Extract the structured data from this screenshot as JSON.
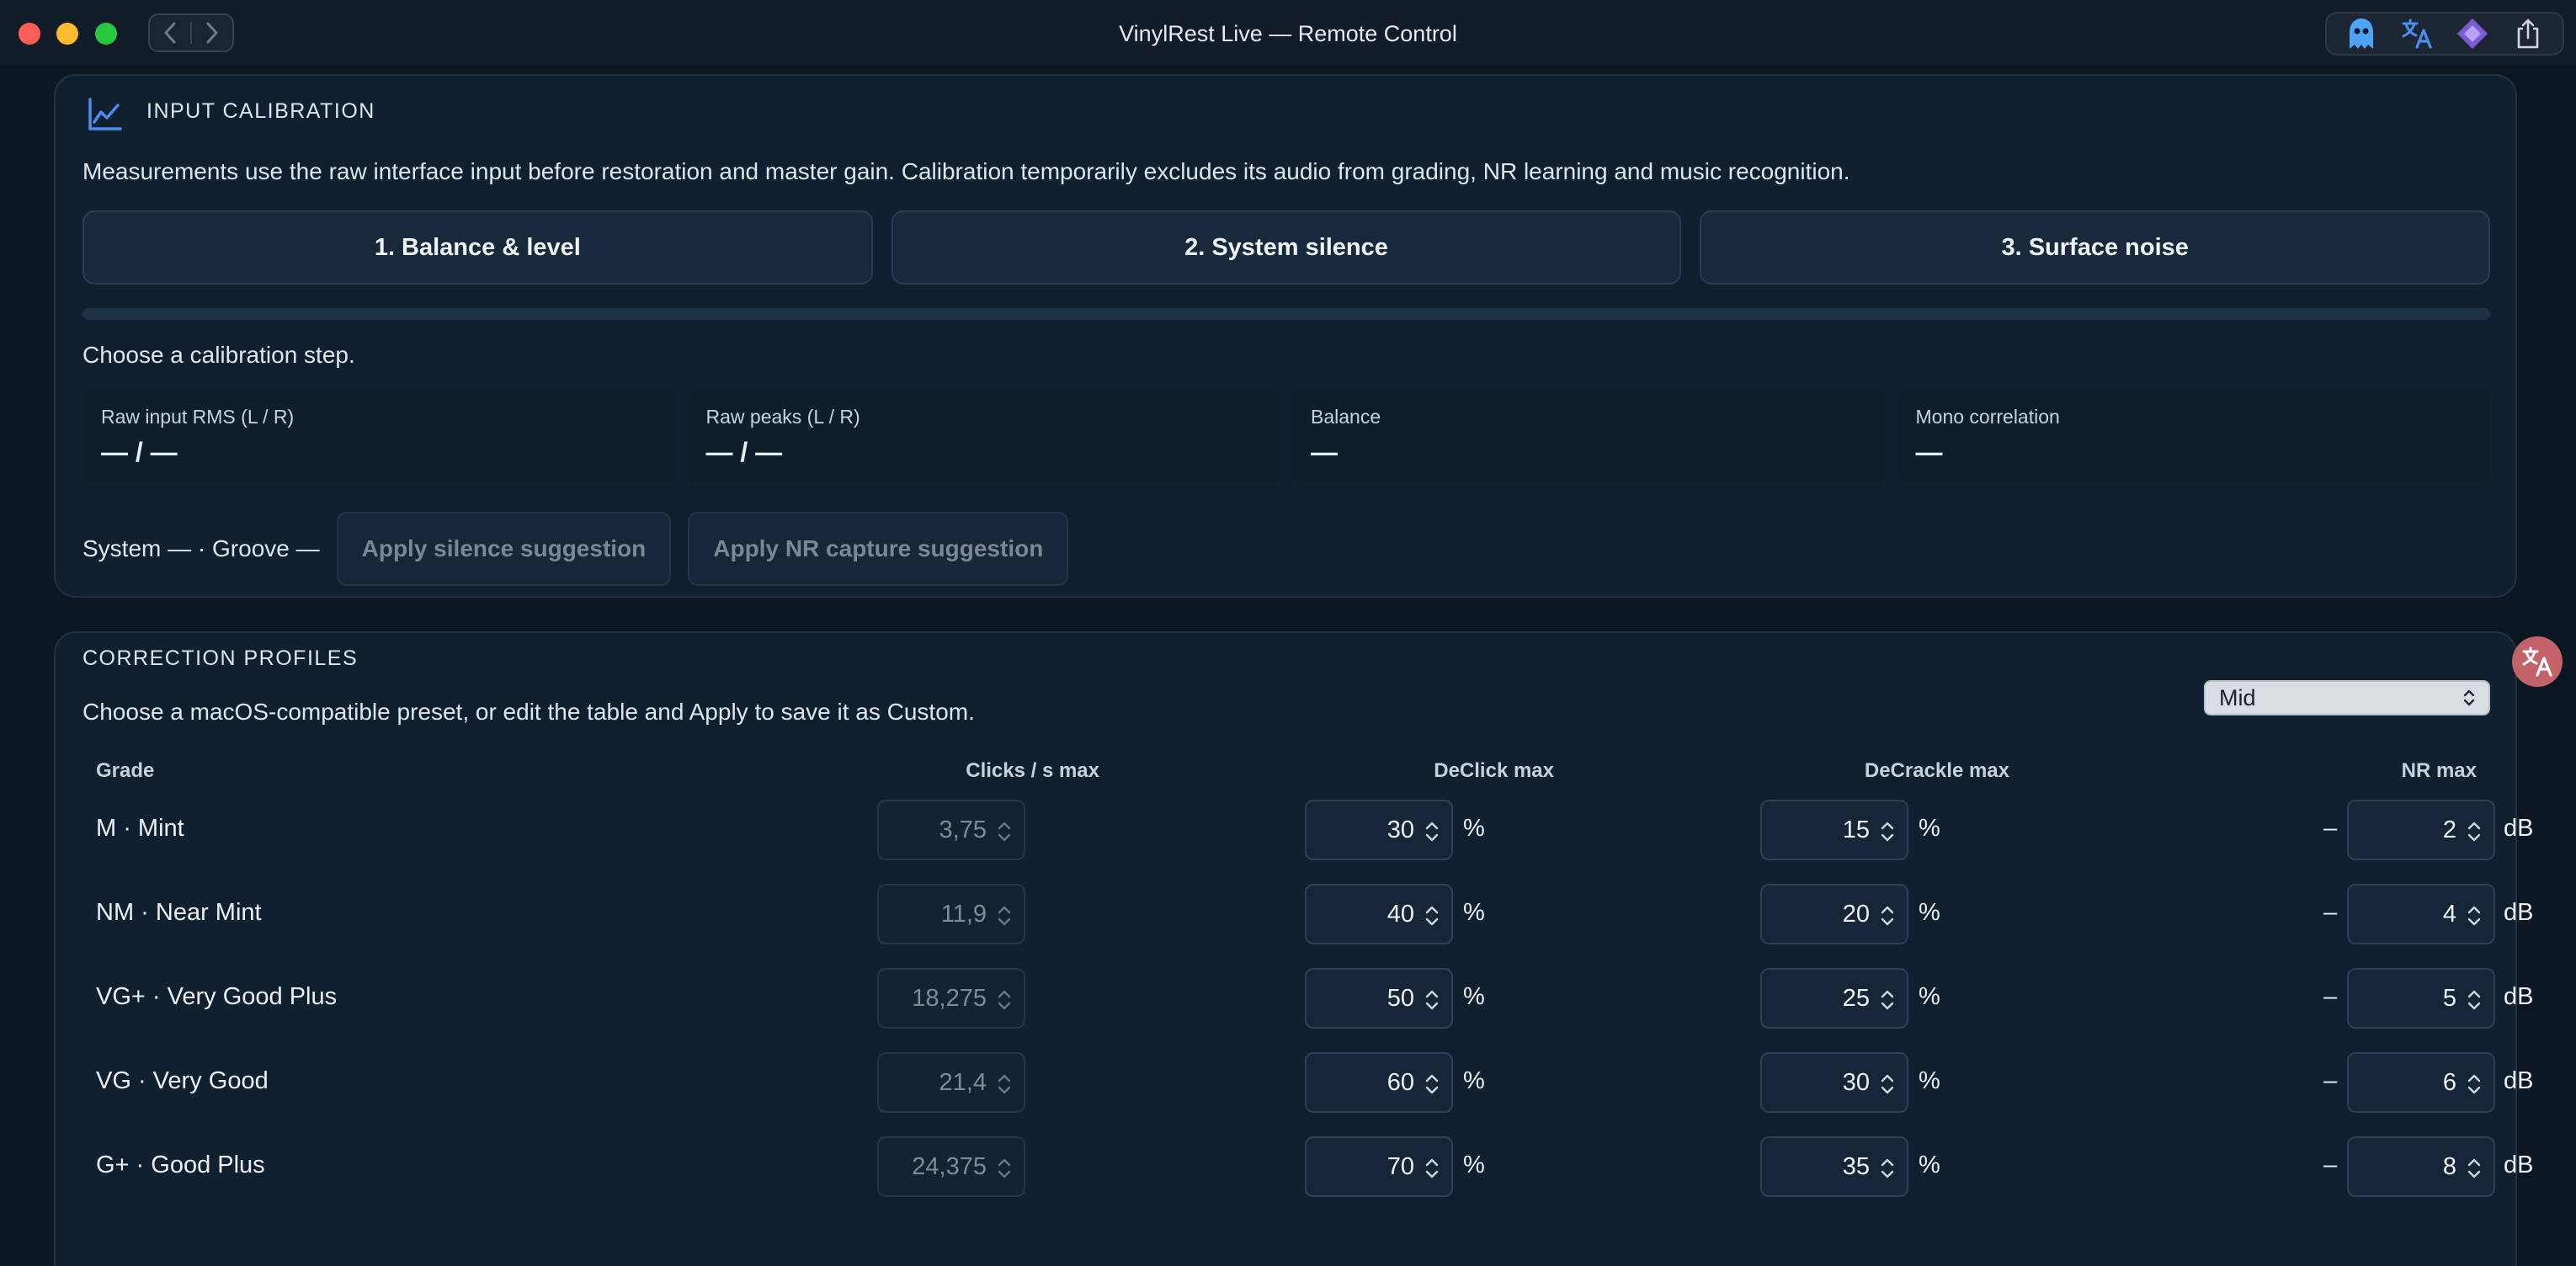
{
  "window": {
    "title": "VinylRest Live — Remote Control"
  },
  "calibration": {
    "title": "INPUT CALIBRATION",
    "description": "Measurements use the raw interface input before restoration and master gain. Calibration temporarily excludes its audio from grading, NR learning and music recognition.",
    "steps": [
      "1. Balance & level",
      "2. System silence",
      "3. Surface noise"
    ],
    "progress_fraction": 0,
    "status": "Choose a calibration step.",
    "meters": [
      {
        "label": "Raw input RMS (L / R)",
        "value": "— / —"
      },
      {
        "label": "Raw peaks (L / R)",
        "value": "— / —"
      },
      {
        "label": "Balance",
        "value": "—"
      },
      {
        "label": "Mono correlation",
        "value": "—"
      }
    ],
    "system_groove": "System — · Groove —",
    "apply_silence": "Apply silence suggestion",
    "apply_nr": "Apply NR capture suggestion"
  },
  "corrections": {
    "title": "CORRECTION PROFILES",
    "description": "Choose a macOS-compatible preset, or edit the table and Apply to save it as Custom.",
    "preset": "Mid",
    "headers": {
      "grade": "Grade",
      "clicks": "Clicks / s max",
      "declick": "DeClick max",
      "decrackle": "DeCrackle max",
      "nr": "NR max"
    },
    "units": {
      "percent": "%",
      "db": "dB",
      "minus": "–"
    },
    "rows": [
      {
        "grade": "M · Mint",
        "clicks": "3,75",
        "declick": "30",
        "decrackle": "15",
        "nr": "2"
      },
      {
        "grade": "NM · Near Mint",
        "clicks": "11,9",
        "declick": "40",
        "decrackle": "20",
        "nr": "4"
      },
      {
        "grade": "VG+ · Very Good Plus",
        "clicks": "18,275",
        "declick": "50",
        "decrackle": "25",
        "nr": "5"
      },
      {
        "grade": "VG · Very Good",
        "clicks": "21,4",
        "declick": "60",
        "decrackle": "30",
        "nr": "6"
      },
      {
        "grade": "G+ · Good Plus",
        "clicks": "24,375",
        "declick": "70",
        "decrackle": "35",
        "nr": "8"
      }
    ]
  },
  "colors": {
    "accent": "#3b82f6",
    "background": "#0b1622",
    "panel": "#102030"
  },
  "icons": [
    "chart-line-icon",
    "back-icon",
    "forward-icon",
    "ghost-extension-icon",
    "translate-icon",
    "diamond-extension-icon",
    "share-icon",
    "chevron-updown-icon"
  ]
}
